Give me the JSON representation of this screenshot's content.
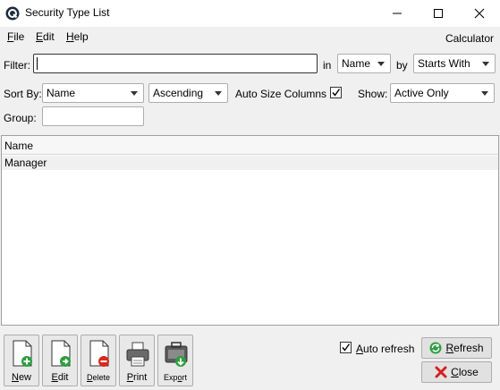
{
  "window": {
    "title": "Security Type List",
    "app_icon": "q-logo-icon",
    "controls": [
      "minimize-icon",
      "maximize-icon",
      "close-icon"
    ]
  },
  "menu": {
    "items": [
      {
        "u": "F",
        "rest": "ile"
      },
      {
        "u": "E",
        "rest": "dit"
      },
      {
        "u": "H",
        "rest": "elp"
      }
    ],
    "calculator": "Calculator"
  },
  "filter": {
    "label": "Filter:",
    "value": "",
    "in_label": "in",
    "in_value": "Name",
    "by_label": "by",
    "by_value": "Starts With"
  },
  "sort": {
    "label": "Sort By:",
    "field": "Name",
    "direction": "Ascending",
    "autosize_label": "Auto Size Columns",
    "autosize_checked": true,
    "show_label": "Show:",
    "show_value": "Active Only"
  },
  "group": {
    "label": "Group:",
    "value": ""
  },
  "list": {
    "columns": [
      "Name"
    ],
    "rows": [
      [
        "Manager"
      ]
    ]
  },
  "toolbar": {
    "buttons": [
      {
        "u": "N",
        "rest": "ew",
        "icon": "new-doc-icon"
      },
      {
        "u": "E",
        "rest": "dit",
        "icon": "edit-doc-icon"
      },
      {
        "u": "D",
        "rest": "elete",
        "icon": "delete-doc-icon"
      },
      {
        "u": "P",
        "rest": "rint",
        "icon": "printer-icon"
      },
      {
        "pre": "Exp",
        "u": "o",
        "rest": "rt",
        "icon": "export-icon"
      }
    ]
  },
  "footer": {
    "autorefresh_u": "A",
    "autorefresh_rest": "uto refresh",
    "autorefresh_checked": true,
    "refresh_u": "R",
    "refresh_rest": "efresh",
    "close_u": "C",
    "close_rest": "lose"
  },
  "colors": {
    "accent_green": "#2e9e3e",
    "delete_red": "#d9281c",
    "close_red": "#d42020"
  }
}
